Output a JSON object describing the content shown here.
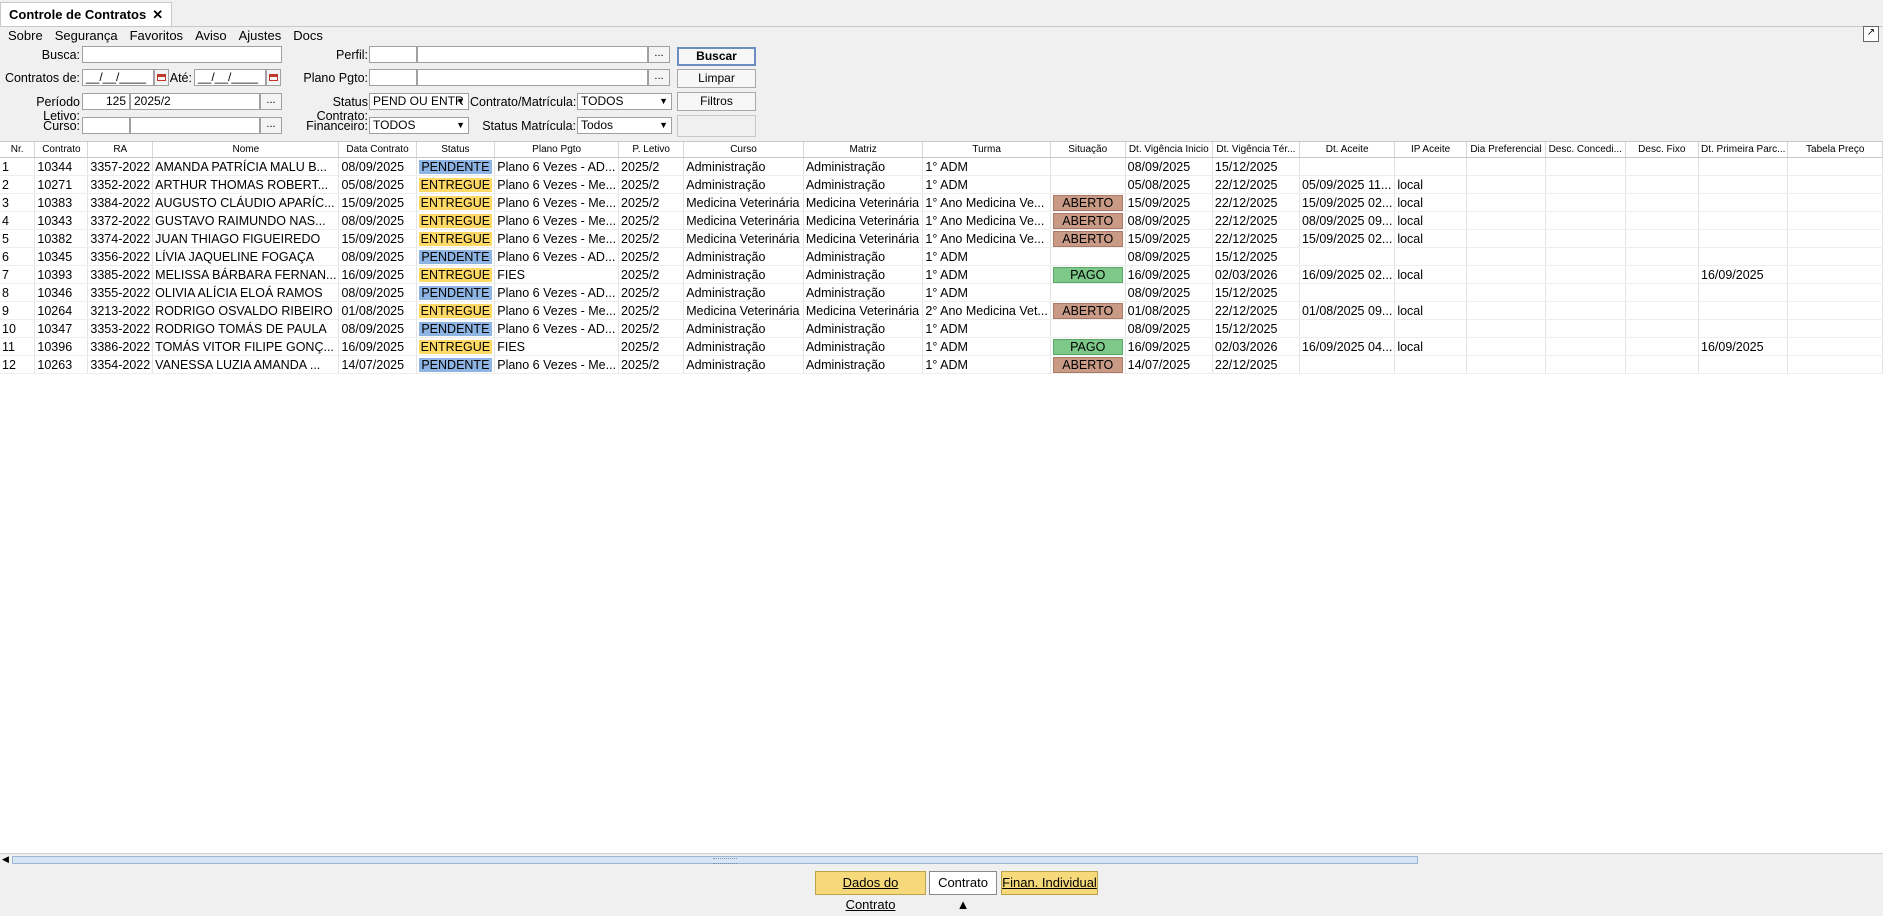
{
  "tab": {
    "title": "Controle de Contratos",
    "close": "✕"
  },
  "menu": [
    "Sobre",
    "Segurança",
    "Favoritos",
    "Aviso",
    "Ajustes",
    "Docs"
  ],
  "filters": {
    "busca_label": "Busca:",
    "busca_value": "",
    "perfil_label": "Perfil:",
    "perfil_code": "",
    "perfil_name": "",
    "contratos_de_label": "Contratos de:",
    "contratos_de_value": "__/__/____",
    "ate_label": "Até:",
    "ate_value": "__/__/____",
    "plano_pgto_label": "Plano Pgto:",
    "plano_code": "",
    "plano_name": "",
    "periodo_label": "Período Letivo:",
    "periodo_code": "125",
    "periodo_name": "2025/2",
    "status_contrato_label": "Status Contrato:",
    "status_contrato_value": "PEND OU ENTR",
    "contrato_matricula_label": "Contrato/Matrícula:",
    "contrato_matricula_value": "TODOS",
    "curso_label": "Curso:",
    "curso_code": "",
    "curso_name": "",
    "financeiro_label": "Financeiro:",
    "financeiro_value": "TODOS",
    "status_matricula_label": "Status Matrícula:",
    "status_matricula_value": "Todos",
    "dots": "..."
  },
  "buttons": {
    "buscar": "Buscar",
    "limpar": "Limpar",
    "filtros": "Filtros"
  },
  "columns": [
    "Nr.",
    "Contrato",
    "RA",
    "Nome",
    "Data Contrato",
    "Status",
    "Plano Pgto",
    "P. Letivo",
    "Curso",
    "Matriz",
    "Turma",
    "Situação",
    "Dt. Vigência Inicio",
    "Dt. Vigência Tér...",
    "Dt. Aceite",
    "IP Aceite",
    "Dia Preferencial",
    "Desc. Concedi...",
    "Desc. Fixo",
    "Dt. Primeira Parc...",
    "Tabela Preço"
  ],
  "rows": [
    [
      "1",
      "10344",
      "3357-2022",
      "AMANDA PATRÍCIA MALU B...",
      "08/09/2025",
      "PENDENTE",
      "Plano 6 Vezes - AD...",
      "2025/2",
      "Administração",
      "Administração",
      "1° ADM",
      "",
      "08/09/2025",
      "15/12/2025",
      "",
      "",
      "",
      "",
      "",
      "",
      ""
    ],
    [
      "2",
      "10271",
      "3352-2022",
      "ARTHUR THOMAS ROBERT...",
      "05/08/2025",
      "ENTREGUE",
      "Plano 6 Vezes - Me...",
      "2025/2",
      "Administração",
      "Administração",
      "1° ADM",
      "",
      "05/08/2025",
      "22/12/2025",
      "05/09/2025 11...",
      "local",
      "",
      "",
      "",
      "",
      ""
    ],
    [
      "3",
      "10383",
      "3384-2022",
      "AUGUSTO CLÁUDIO APARÍC...",
      "15/09/2025",
      "ENTREGUE",
      "Plano 6 Vezes - Me...",
      "2025/2",
      "Medicina Veterinária",
      "Medicina Veterinária",
      "1°  Ano Medicina Ve...",
      "ABERTO",
      "15/09/2025",
      "22/12/2025",
      "15/09/2025 02...",
      "local",
      "",
      "",
      "",
      "",
      ""
    ],
    [
      "4",
      "10343",
      "3372-2022",
      "GUSTAVO RAIMUNDO NAS...",
      "08/09/2025",
      "ENTREGUE",
      "Plano 6 Vezes - Me...",
      "2025/2",
      "Medicina Veterinária",
      "Medicina Veterinária",
      "1°  Ano Medicina Ve...",
      "ABERTO",
      "08/09/2025",
      "22/12/2025",
      "08/09/2025 09...",
      "local",
      "",
      "",
      "",
      "",
      ""
    ],
    [
      "5",
      "10382",
      "3374-2022",
      "JUAN THIAGO FIGUEIREDO",
      "15/09/2025",
      "ENTREGUE",
      "Plano 6 Vezes - Me...",
      "2025/2",
      "Medicina Veterinária",
      "Medicina Veterinária",
      "1°  Ano Medicina Ve...",
      "ABERTO",
      "15/09/2025",
      "22/12/2025",
      "15/09/2025 02...",
      "local",
      "",
      "",
      "",
      "",
      ""
    ],
    [
      "6",
      "10345",
      "3356-2022",
      "LÍVIA JAQUELINE FOGAÇA",
      "08/09/2025",
      "PENDENTE",
      "Plano 6 Vezes - AD...",
      "2025/2",
      "Administração",
      "Administração",
      "1° ADM",
      "",
      "08/09/2025",
      "15/12/2025",
      "",
      "",
      "",
      "",
      "",
      "",
      ""
    ],
    [
      "7",
      "10393",
      "3385-2022",
      "MELISSA BÁRBARA FERNAN...",
      "16/09/2025",
      "ENTREGUE",
      "FIES",
      "2025/2",
      "Administração",
      "Administração",
      "1° ADM",
      "PAGO",
      "16/09/2025",
      "02/03/2026",
      "16/09/2025 02...",
      "local",
      "",
      "",
      "",
      "16/09/2025",
      ""
    ],
    [
      "8",
      "10346",
      "3355-2022",
      "OLIVIA ALÍCIA ELOÁ RAMOS",
      "08/09/2025",
      "PENDENTE",
      "Plano 6 Vezes - AD...",
      "2025/2",
      "Administração",
      "Administração",
      "1° ADM",
      "",
      "08/09/2025",
      "15/12/2025",
      "",
      "",
      "",
      "",
      "",
      "",
      ""
    ],
    [
      "9",
      "10264",
      "3213-2022",
      "RODRIGO OSVALDO RIBEIRO",
      "01/08/2025",
      "ENTREGUE",
      "Plano 6 Vezes - Me...",
      "2025/2",
      "Medicina Veterinária",
      "Medicina Veterinária",
      "2° Ano Medicina Vet...",
      "ABERTO",
      "01/08/2025",
      "22/12/2025",
      "01/08/2025 09...",
      "local",
      "",
      "",
      "",
      "",
      ""
    ],
    [
      "10",
      "10347",
      "3353-2022",
      "RODRIGO TOMÁS DE PAULA",
      "08/09/2025",
      "PENDENTE",
      "Plano 6 Vezes - AD...",
      "2025/2",
      "Administração",
      "Administração",
      "1° ADM",
      "",
      "08/09/2025",
      "15/12/2025",
      "",
      "",
      "",
      "",
      "",
      "",
      ""
    ],
    [
      "11",
      "10396",
      "3386-2022",
      "TOMÁS VITOR FILIPE GONÇ...",
      "16/09/2025",
      "ENTREGUE",
      "FIES",
      "2025/2",
      "Administração",
      "Administração",
      "1° ADM",
      "PAGO",
      "16/09/2025",
      "02/03/2026",
      "16/09/2025 04...",
      "local",
      "",
      "",
      "",
      "16/09/2025",
      ""
    ],
    [
      "12",
      "10263",
      "3354-2022",
      "VANESSA LUZIA AMANDA ...",
      "14/07/2025",
      "PENDENTE",
      "Plano 6 Vezes - Me...",
      "2025/2",
      "Administração",
      "Administração",
      "1° ADM",
      "ABERTO",
      "14/07/2025",
      "22/12/2025",
      "",
      "",
      "",
      "",
      "",
      "",
      ""
    ]
  ],
  "bottom": {
    "dados": "Dados do Contrato",
    "contrato": "Contrato ▲",
    "finan": "Finan. Individual"
  },
  "colors": {
    "pendente": "#8db4e2",
    "entregue": "#ffd966",
    "aberto": "#c99b87",
    "pago": "#7ec98a"
  }
}
